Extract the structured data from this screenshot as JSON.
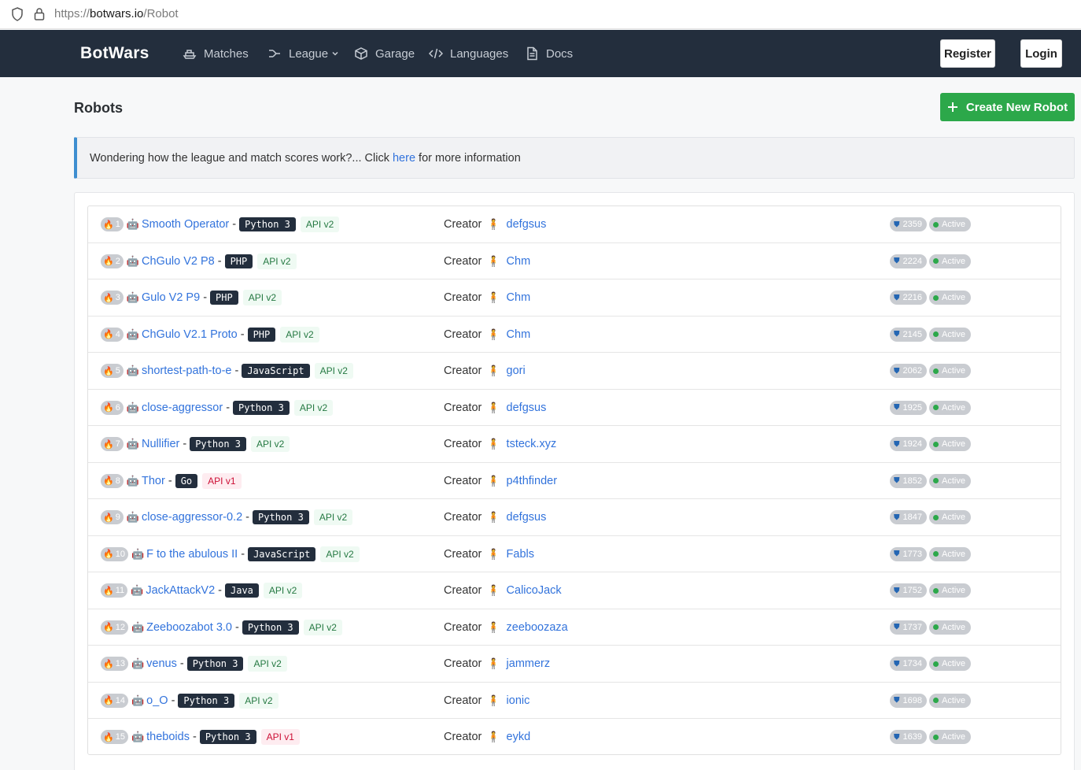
{
  "browser": {
    "url_scheme": "https://",
    "url_host": "botwars.io",
    "url_path": "/Robot"
  },
  "nav": {
    "brand": "BotWars",
    "items": [
      {
        "label": "Matches",
        "icon": "ship-icon"
      },
      {
        "label": "League",
        "icon": "route-icon",
        "dropdown": true
      },
      {
        "label": "Garage",
        "icon": "cube-icon"
      },
      {
        "label": "Languages",
        "icon": "code-icon"
      },
      {
        "label": "Docs",
        "icon": "document-icon"
      }
    ],
    "register": "Register",
    "login": "Login"
  },
  "page": {
    "title": "Robots",
    "create_button": "Create New Robot"
  },
  "notice": {
    "before": "Wondering how the league and match scores work?... Click ",
    "link": "here",
    "after": " for more information"
  },
  "creator_label": "Creator",
  "status_label": "Active",
  "colors": {
    "navbar": "#232e3d",
    "accent_green": "#2ca84a",
    "link_blue": "#3273dc"
  },
  "robots": [
    {
      "rank": "1",
      "name": "Smooth Operator",
      "language": "Python 3",
      "api": "API v2",
      "creator": "defgsus",
      "score": "2359"
    },
    {
      "rank": "2",
      "name": "ChGulo V2 P8",
      "language": "PHP",
      "api": "API v2",
      "creator": "Chm",
      "score": "2224"
    },
    {
      "rank": "3",
      "name": "Gulo V2 P9",
      "language": "PHP",
      "api": "API v2",
      "creator": "Chm",
      "score": "2216"
    },
    {
      "rank": "4",
      "name": "ChGulo V2.1 Proto",
      "language": "PHP",
      "api": "API v2",
      "creator": "Chm",
      "score": "2145"
    },
    {
      "rank": "5",
      "name": "shortest-path-to-e",
      "language": "JavaScript",
      "api": "API v2",
      "creator": "gori",
      "score": "2062"
    },
    {
      "rank": "6",
      "name": "close-aggressor",
      "language": "Python 3",
      "api": "API v2",
      "creator": "defgsus",
      "score": "1925"
    },
    {
      "rank": "7",
      "name": "Nullifier",
      "language": "Python 3",
      "api": "API v2",
      "creator": "tsteck.xyz",
      "score": "1924"
    },
    {
      "rank": "8",
      "name": "Thor",
      "language": "Go",
      "api": "API v1",
      "creator": "p4thfinder",
      "score": "1852"
    },
    {
      "rank": "9",
      "name": "close-aggressor-0.2",
      "language": "Python 3",
      "api": "API v2",
      "creator": "defgsus",
      "score": "1847"
    },
    {
      "rank": "10",
      "name": "F to the abulous II",
      "language": "JavaScript",
      "api": "API v2",
      "creator": "Fabls",
      "score": "1773"
    },
    {
      "rank": "11",
      "name": "JackAttackV2",
      "language": "Java",
      "api": "API v2",
      "creator": "CalicoJack",
      "score": "1752"
    },
    {
      "rank": "12",
      "name": "Zeeboozabot 3.0",
      "language": "Python 3",
      "api": "API v2",
      "creator": "zeeboozaza",
      "score": "1737"
    },
    {
      "rank": "13",
      "name": "venus",
      "language": "Python 3",
      "api": "API v2",
      "creator": "jammerz",
      "score": "1734"
    },
    {
      "rank": "14",
      "name": "o_O",
      "language": "Python 3",
      "api": "API v2",
      "creator": "ionic",
      "score": "1698"
    },
    {
      "rank": "15",
      "name": "theboids",
      "language": "Python 3",
      "api": "API v1",
      "creator": "eykd",
      "score": "1639"
    }
  ]
}
